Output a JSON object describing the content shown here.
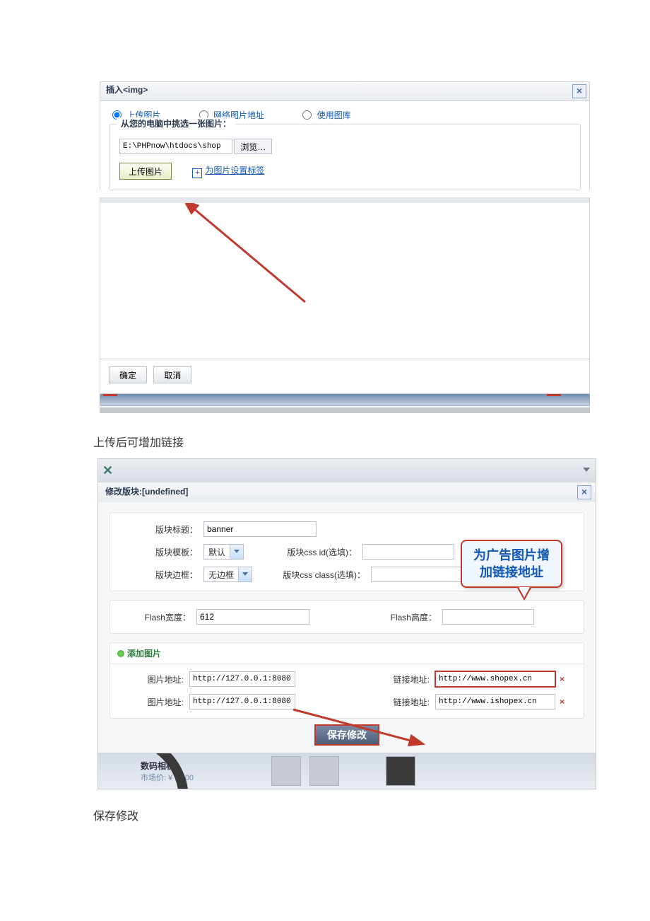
{
  "dialog1": {
    "title": "插入<img>",
    "radios": {
      "upload": "上传图片",
      "url": "网络图片地址",
      "library": "使用图库"
    },
    "legend": "从您的电脑中挑选一张图片：",
    "file_value": "E:\\PHPnow\\htdocs\\shop",
    "browse": "浏览…",
    "upload_btn": "上传图片",
    "set_label_link": "为图片设置标签",
    "ok": "确定",
    "cancel": "取消"
  },
  "caption1": "上传后可增加链接",
  "dialog2": {
    "title": "修改版块:[undefined]",
    "labels": {
      "block_title": "版块标题：",
      "block_tpl": "版块模板：",
      "block_border": "版块边框：",
      "css_id": "版块css id(选填)：",
      "css_class": "版块css class(选填)：",
      "flash_w": "Flash宽度：",
      "flash_h": "Flash高度："
    },
    "values": {
      "block_title": "banner",
      "block_tpl": "默认",
      "block_border": "无边框",
      "css_id": "",
      "css_class": "",
      "flash_w": "612",
      "flash_h": ""
    },
    "callout_line1": "为广告图片增",
    "callout_line2": "加链接地址",
    "add_image": "添加图片",
    "img_addr_label": "图片地址:",
    "link_addr_label": "链接地址:",
    "rows": [
      {
        "img": "http://127.0.0.1:8080",
        "link": "http://www.shopex.cn"
      },
      {
        "img": "http://127.0.0.1:8080",
        "link": "http://www.ishopex.cn"
      }
    ],
    "save": "保存修改",
    "product": {
      "name": "数码相机1",
      "price": "市场价: ¥ 11.00"
    }
  },
  "caption2": "保存修改"
}
